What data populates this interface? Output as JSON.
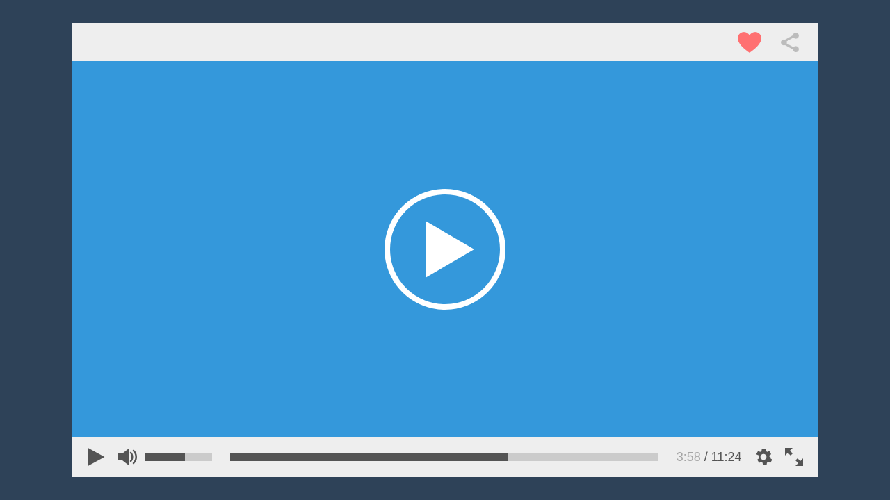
{
  "player": {
    "colors": {
      "background": "#2e4258",
      "chrome": "#eeeeee",
      "video": "#3498db",
      "heart": "#ff7071",
      "icon_muted": "#bcbcbc",
      "icon_dark": "#545454",
      "track": "#cbcbcb",
      "time_current": "#a5a5a5",
      "time_total": "#545454",
      "play_ring": "#ffffff"
    },
    "volume_percent": 60,
    "progress_percent": 65,
    "time": {
      "current": "3:58",
      "separator": " / ",
      "total": "11:24"
    }
  }
}
